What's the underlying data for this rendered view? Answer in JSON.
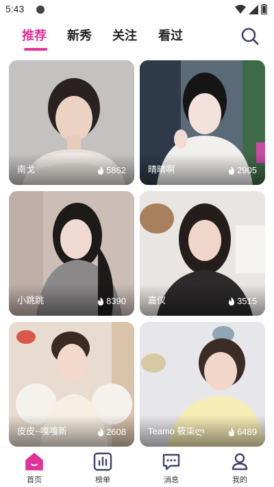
{
  "status": {
    "time": "5:43"
  },
  "tabs": [
    {
      "label": "推荐",
      "active": true
    },
    {
      "label": "新秀",
      "active": false
    },
    {
      "label": "关注",
      "active": false
    },
    {
      "label": "看过",
      "active": false
    }
  ],
  "cards": [
    {
      "name": "南戈",
      "count": "5862"
    },
    {
      "name": "晴晴啊",
      "count": "2905"
    },
    {
      "name": "小跳跳",
      "count": "8390"
    },
    {
      "name": "嘉仪",
      "count": "3515"
    },
    {
      "name": "皮皮~嘎嘎新",
      "count": "2608"
    },
    {
      "name": "Teamo 筱柒ლ",
      "count": "6489"
    }
  ],
  "nav": [
    {
      "label": "首页",
      "icon": "home-icon",
      "active": true
    },
    {
      "label": "榜单",
      "icon": "chart-icon",
      "active": false
    },
    {
      "label": "消息",
      "icon": "message-icon",
      "active": false
    },
    {
      "label": "我的",
      "icon": "profile-icon",
      "active": false
    }
  ],
  "colors": {
    "accent": "#e0339a",
    "nav_icon": "#3e4566"
  }
}
